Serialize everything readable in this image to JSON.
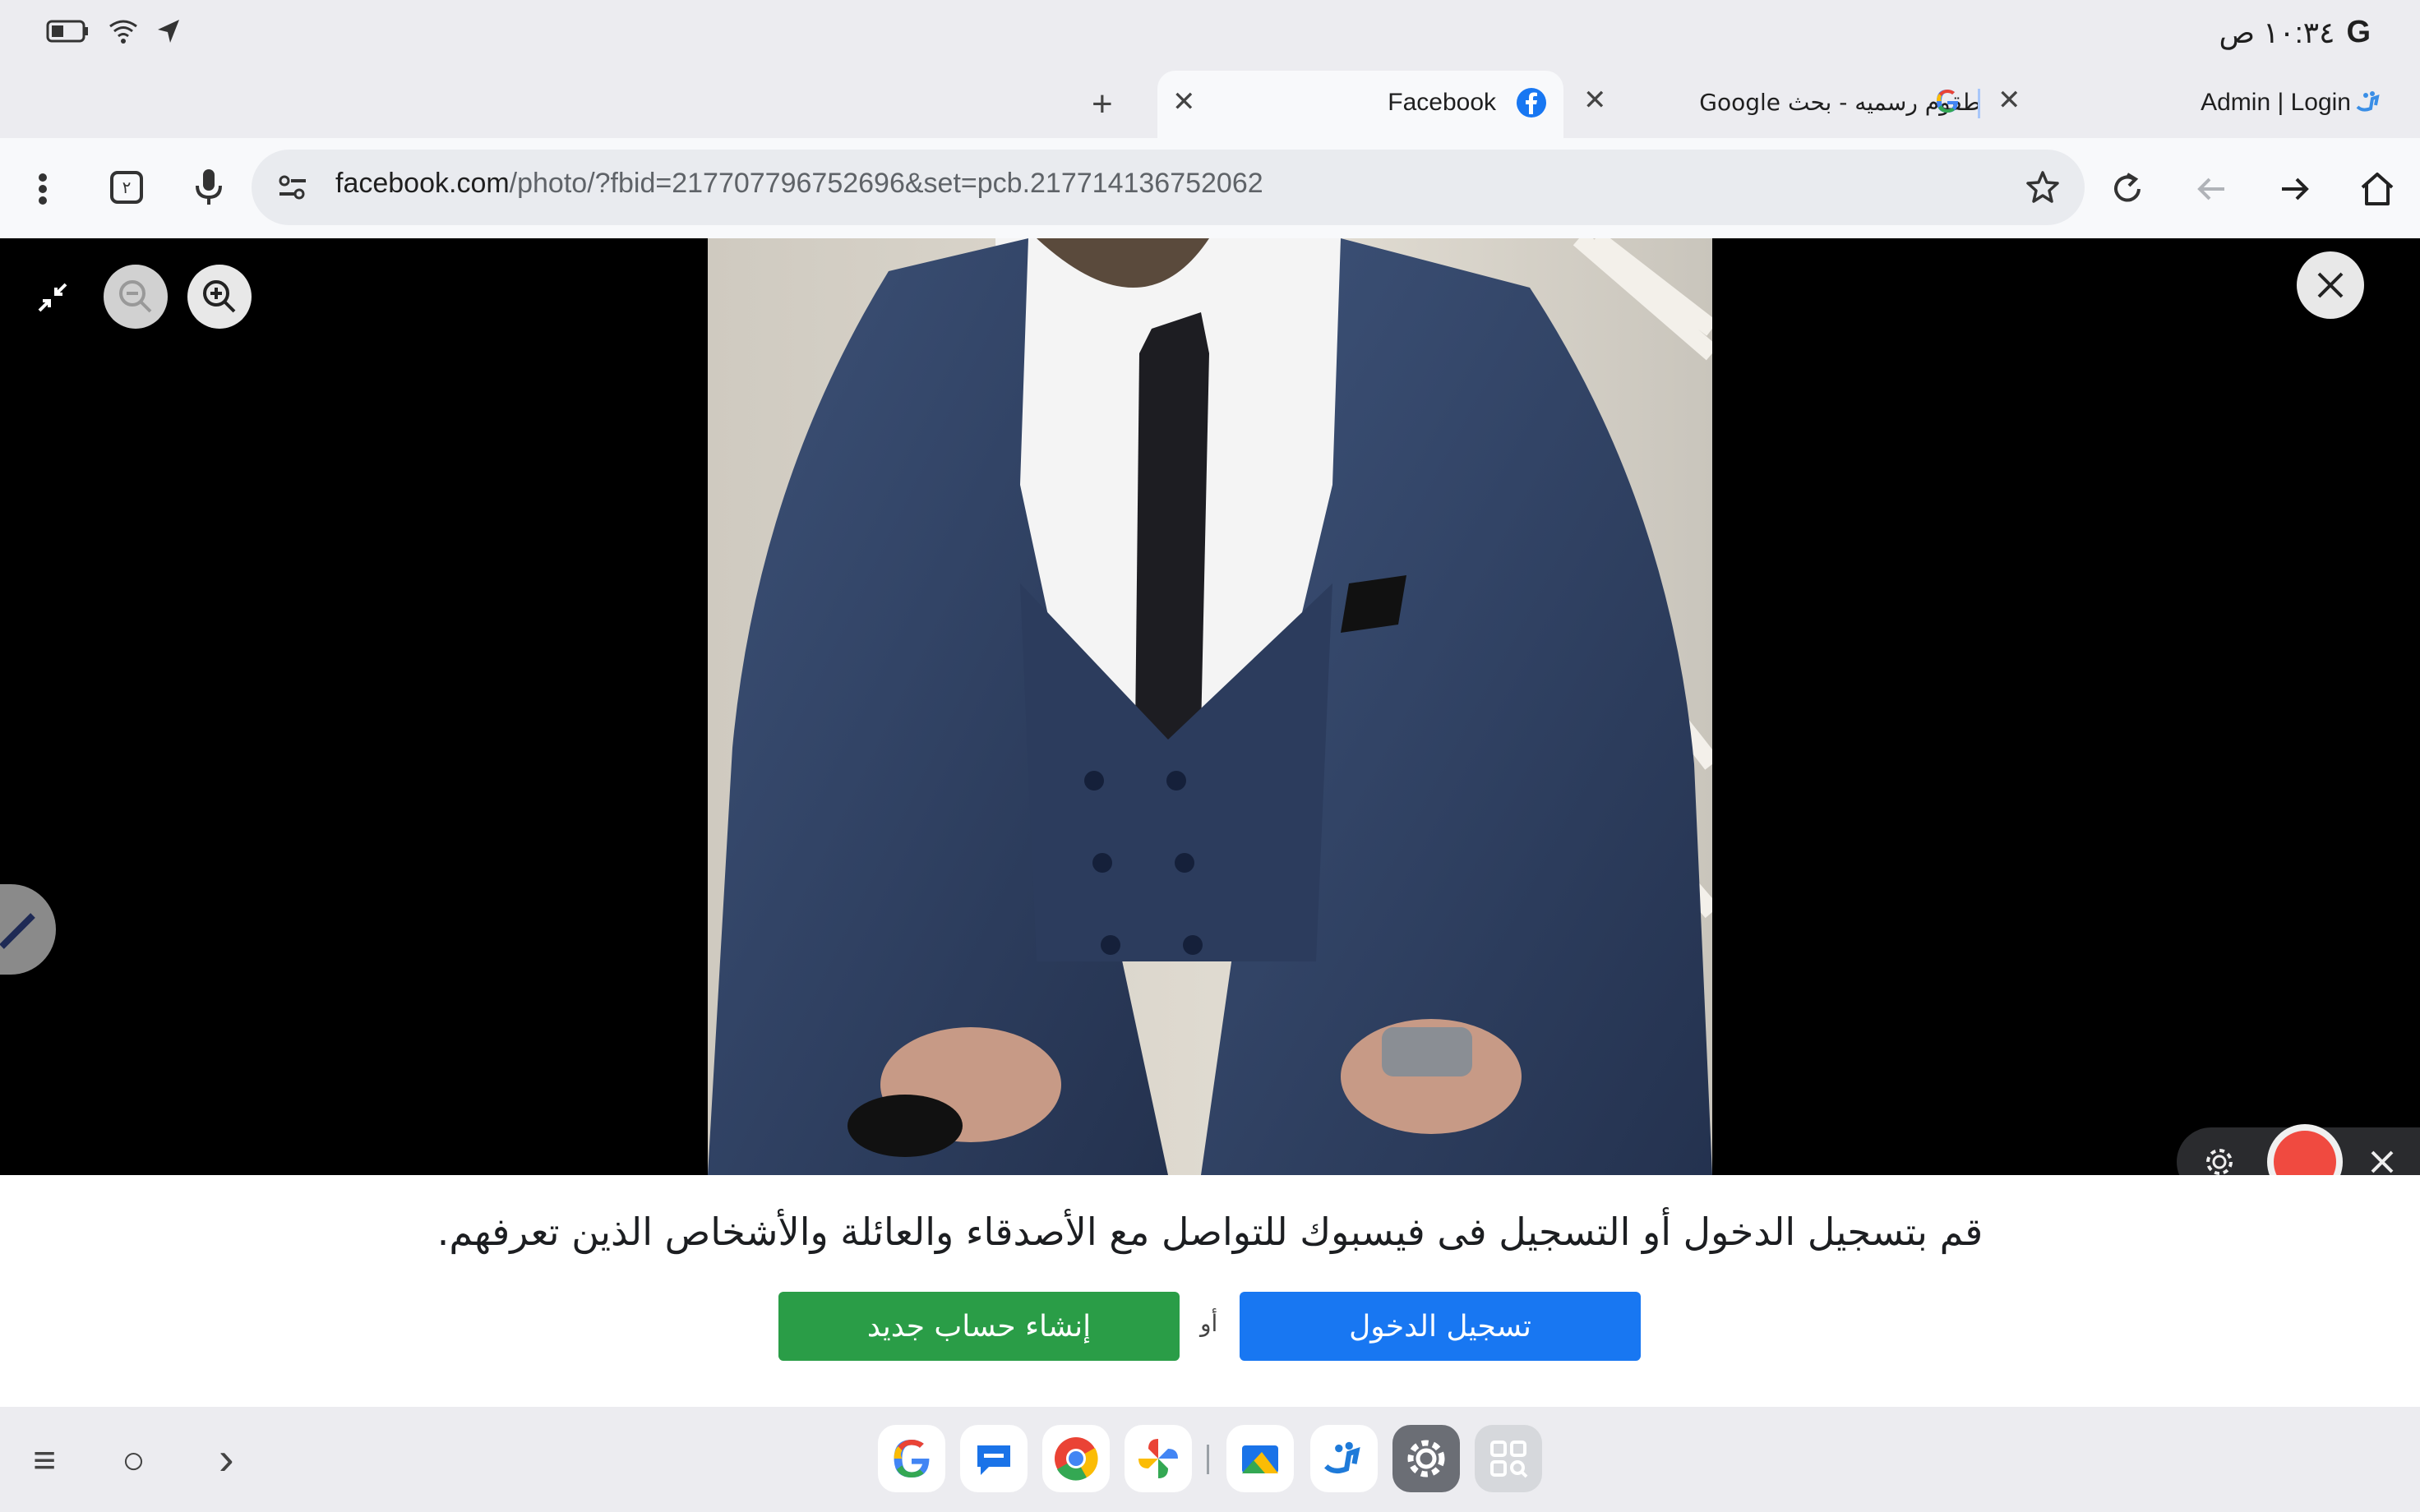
{
  "status_bar": {
    "time": "١٠:٣٤ ص",
    "google_letter": "G",
    "icons": [
      "battery-icon",
      "wifi-icon",
      "location-arrow-icon"
    ]
  },
  "tabs": [
    {
      "title": "Admin | Login",
      "icon": "site-logo-icon",
      "active": false
    },
    {
      "title": "طقوم رسميه - بحث Google",
      "icon": "google-g-icon",
      "active": false
    },
    {
      "title": "Facebook",
      "icon": "facebook-icon",
      "active": true
    }
  ],
  "tab_close_glyph": "✕",
  "new_tab_glyph": "+",
  "toolbar": {
    "url_host": "facebook.com",
    "url_path": "/photo/?fbid=217707796752696&set=pcb.217714136752062",
    "tab_count": "٢"
  },
  "banner": {
    "message": "قم بتسجيل الدخول أو التسجيل فى فيسبوك للتواصل مع الأصدقاء والعائلة والأشخاص الذين تعرفهم.",
    "login_label": "تسجيل الدخول",
    "or_label": "أو",
    "create_label": "إنشاء حساب جديد"
  },
  "colors": {
    "facebook_blue": "#1877f2",
    "create_green": "#2a9d47",
    "record_red": "#f04a40"
  },
  "dock": {
    "nav": [
      "≡",
      "○",
      "›"
    ],
    "apps": [
      "google-app-icon",
      "messages-app-icon",
      "chrome-app-icon",
      "photos-app-icon",
      "files-app-icon",
      "tqm-app-icon",
      "settings-app-icon",
      "app-grid-icon"
    ]
  }
}
